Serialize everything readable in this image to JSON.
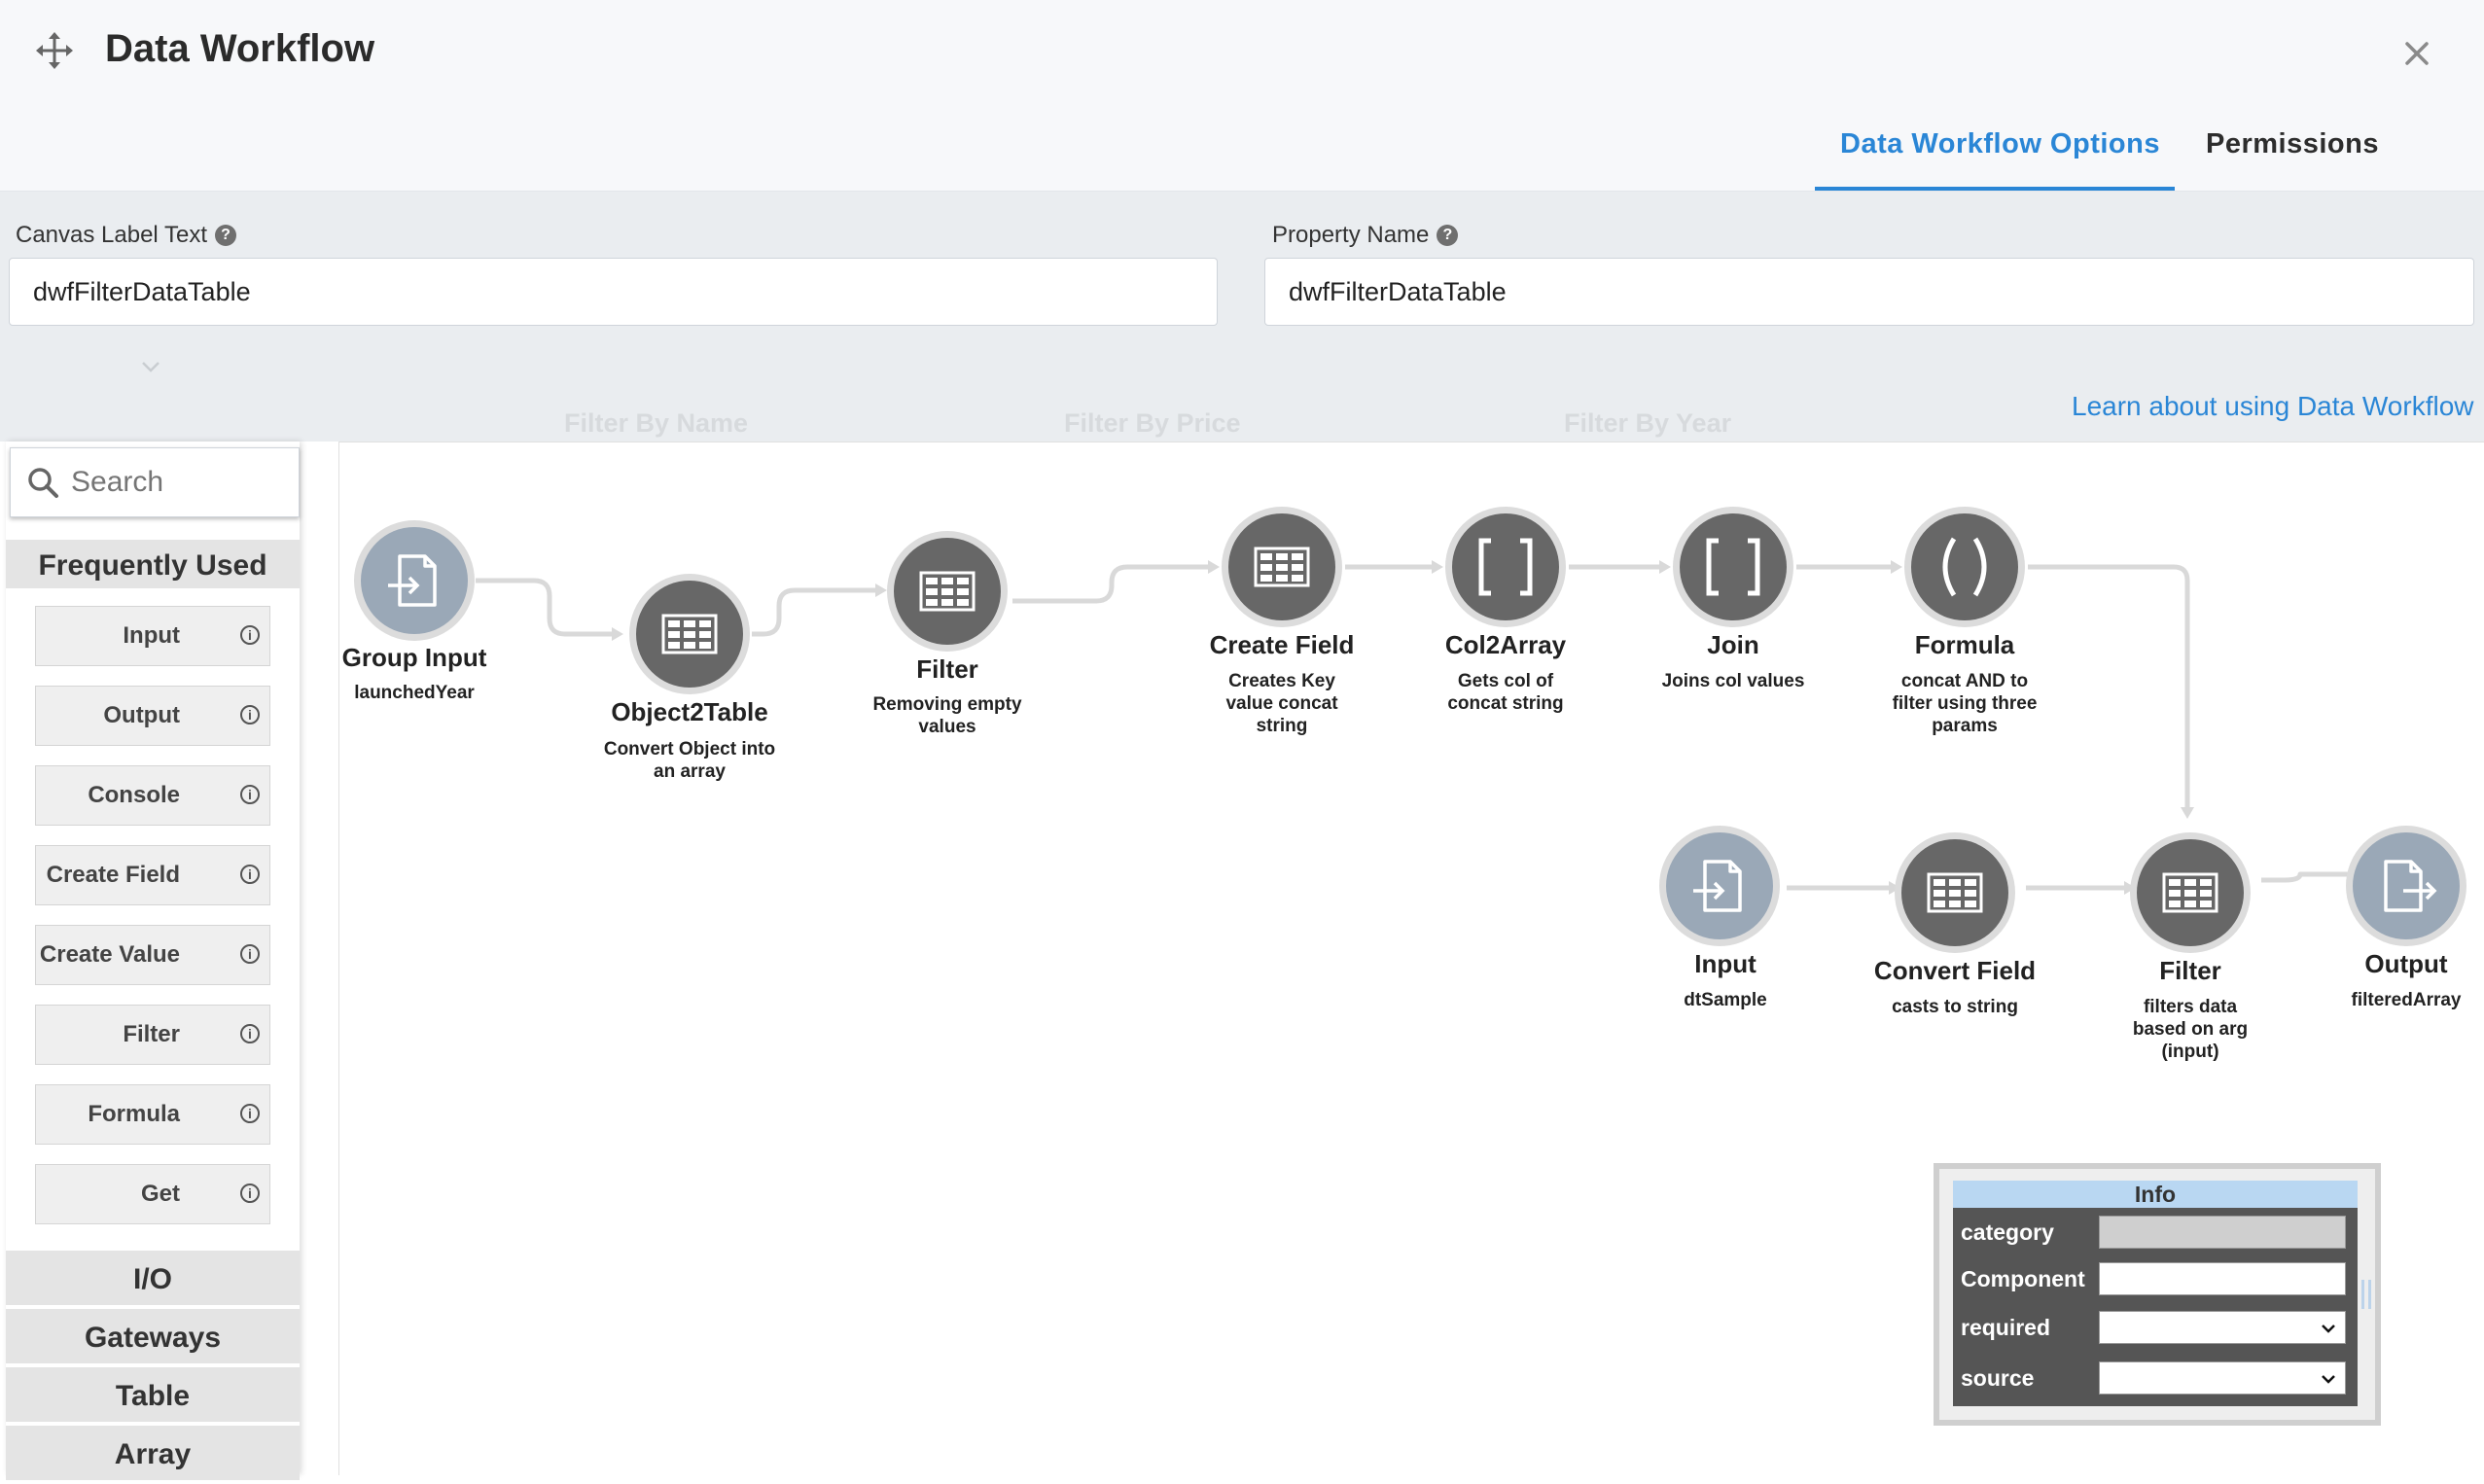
{
  "header": {
    "title": "Data Workflow",
    "tabs": [
      {
        "label": "Data Workflow Options",
        "active": true
      },
      {
        "label": "Permissions",
        "active": false
      }
    ]
  },
  "form": {
    "canvas_label": {
      "label": "Canvas Label Text",
      "value": "dwfFilterDataTable"
    },
    "property_name": {
      "label": "Property Name",
      "value": "dwfFilterDataTable"
    },
    "background_ghost": [
      "Filter By Name",
      "Filter By Price",
      "Filter By Year"
    ],
    "learn_link": "Learn about using Data Workflow"
  },
  "palette": {
    "search_placeholder": "Search",
    "sections": [
      "Frequently Used",
      "I/O",
      "Gateways",
      "Table",
      "Array"
    ],
    "items": [
      "Input",
      "Output",
      "Console",
      "Create Field",
      "Create Value",
      "Filter",
      "Formula",
      "Get"
    ]
  },
  "nodes": [
    {
      "id": "group-input",
      "title": "Group Input",
      "subtitle": "launchedYear",
      "style": "light",
      "icon": "input-file-icon"
    },
    {
      "id": "object2table",
      "title": "Object2Table",
      "subtitle": "Convert Object into an array",
      "style": "dark",
      "icon": "table-icon"
    },
    {
      "id": "filter-1",
      "title": "Filter",
      "subtitle": "Removing empty values",
      "style": "dark",
      "icon": "table-icon"
    },
    {
      "id": "create-field",
      "title": "Create Field",
      "subtitle": "Creates Key value concat string",
      "style": "dark",
      "icon": "table-icon"
    },
    {
      "id": "col2array",
      "title": "Col2Array",
      "subtitle": "Gets col of concat string",
      "style": "dark",
      "icon": "brackets-icon"
    },
    {
      "id": "join",
      "title": "Join",
      "subtitle": "Joins col values",
      "style": "dark",
      "icon": "brackets-icon"
    },
    {
      "id": "formula",
      "title": "Formula",
      "subtitle": "concat AND to filter using three params",
      "style": "dark",
      "icon": "parentheses-icon"
    },
    {
      "id": "input",
      "title": "Input",
      "subtitle": "dtSample",
      "style": "light",
      "icon": "input-file-icon"
    },
    {
      "id": "convert-field",
      "title": "Convert Field",
      "subtitle": "casts to string",
      "style": "dark",
      "icon": "table-icon"
    },
    {
      "id": "filter-2",
      "title": "Filter",
      "subtitle": "filters data based on arg (input)",
      "style": "dark",
      "icon": "table-icon"
    },
    {
      "id": "output",
      "title": "Output",
      "subtitle": "filteredArray",
      "style": "light",
      "icon": "output-file-icon"
    }
  ],
  "info_panel": {
    "title": "Info",
    "rows": [
      {
        "label": "category",
        "value": "",
        "kind": "disabled"
      },
      {
        "label": "Component",
        "value": "",
        "kind": "text"
      },
      {
        "label": "required",
        "value": "",
        "kind": "select"
      },
      {
        "label": "source",
        "value": "",
        "kind": "select"
      }
    ]
  },
  "colors": {
    "accent": "#2a86d6",
    "node_dark": "#676767",
    "node_light": "#9aa8b7",
    "edge": "#d9d9d9"
  }
}
